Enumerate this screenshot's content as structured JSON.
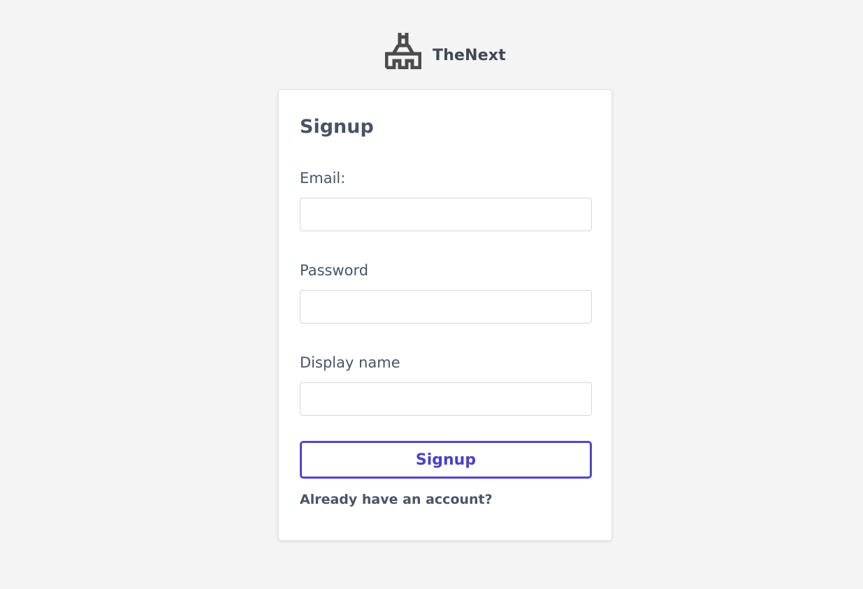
{
  "brand": {
    "name": "TheNext",
    "logo_icon": "castle-tower-icon",
    "logo_color": "#4b4b4b"
  },
  "form": {
    "title": "Signup",
    "fields": [
      {
        "label": "Email:",
        "value": "",
        "placeholder": ""
      },
      {
        "label": "Password",
        "value": "",
        "placeholder": ""
      },
      {
        "label": "Display name",
        "value": "",
        "placeholder": ""
      }
    ],
    "submit_label": "Signup",
    "login_link": "Already have an account?"
  },
  "colors": {
    "background": "#f4f4f4",
    "card": "#ffffff",
    "accent": "#4f46e5",
    "text": "#475569"
  }
}
